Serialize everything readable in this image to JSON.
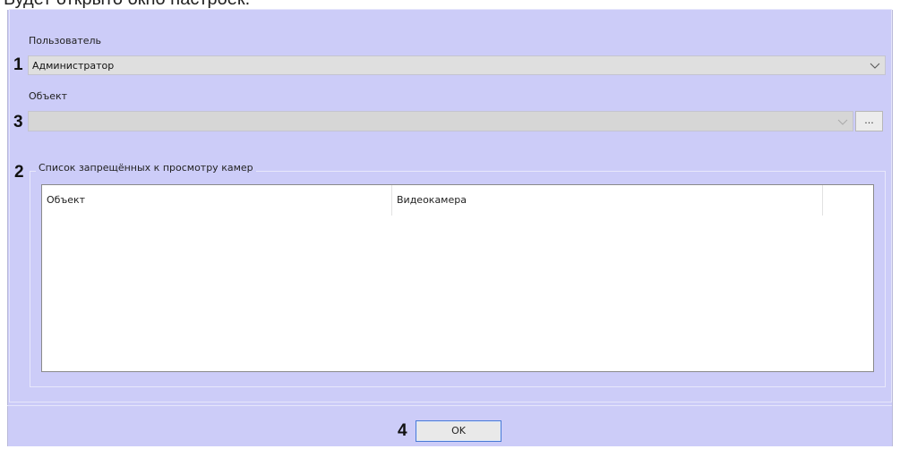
{
  "top_caption": "Будет открыто окно настроек.",
  "markers": {
    "user": "1",
    "list": "2",
    "object": "3",
    "ok": "4"
  },
  "user_field": {
    "label": "Пользователь",
    "value": "Администратор"
  },
  "object_field": {
    "label": "Объект",
    "value": "",
    "browse_label": "..."
  },
  "camera_list": {
    "title": "Список запрещённых к просмотру камер",
    "columns": [
      "Объект",
      "Видеокамера"
    ],
    "rows": []
  },
  "ok_button": {
    "label": "OK"
  },
  "colors": {
    "window_background": "#ccccf8",
    "ok_border": "#4a7bd6"
  },
  "icons": {
    "combo_arrow": "chevron-down-icon"
  }
}
